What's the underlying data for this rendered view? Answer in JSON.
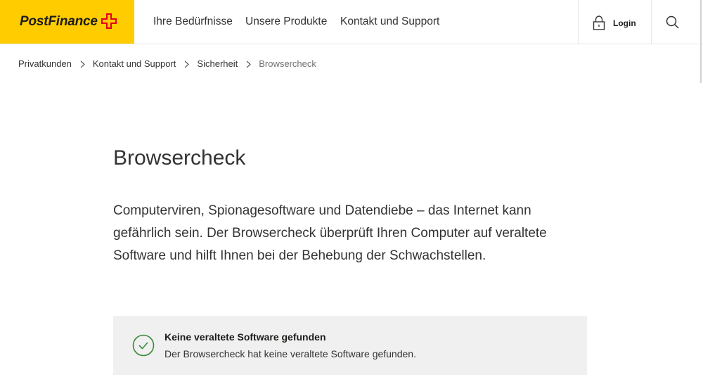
{
  "header": {
    "logo_text": "PostFinance",
    "nav": [
      {
        "label": "Ihre Bedürfnisse"
      },
      {
        "label": "Unsere Produkte"
      },
      {
        "label": "Kontakt und Support"
      }
    ],
    "login_label": "Login",
    "icons": {
      "logo": "swiss-cross-icon",
      "login": "lock-icon",
      "search": "search-icon"
    }
  },
  "breadcrumb": {
    "items": [
      {
        "label": "Privatkunden"
      },
      {
        "label": "Kontakt und Support"
      },
      {
        "label": "Sicherheit"
      },
      {
        "label": "Browsercheck"
      }
    ],
    "separator_icon": "chevron-right-icon"
  },
  "main": {
    "title": "Browsercheck",
    "intro": "Computerviren, Spionagesoftware und Datendiebe – das Internet kann gefährlich sein. Der Browsercheck überprüft Ihren Computer auf veraltete Software und hilft Ihnen bei der Behebung der Schwachstellen."
  },
  "status_box": {
    "icon": "check-circle-icon",
    "title": "Keine veraltete Software gefunden",
    "message": "Der Browsercheck hat keine veraltete Software gefunden."
  },
  "colors": {
    "brand_yellow": "#FFCC00",
    "brand_red": "#E2001A",
    "text": "#333333",
    "muted": "#707070",
    "box_background": "#F0F0F0",
    "success": "#3A8A3A"
  }
}
